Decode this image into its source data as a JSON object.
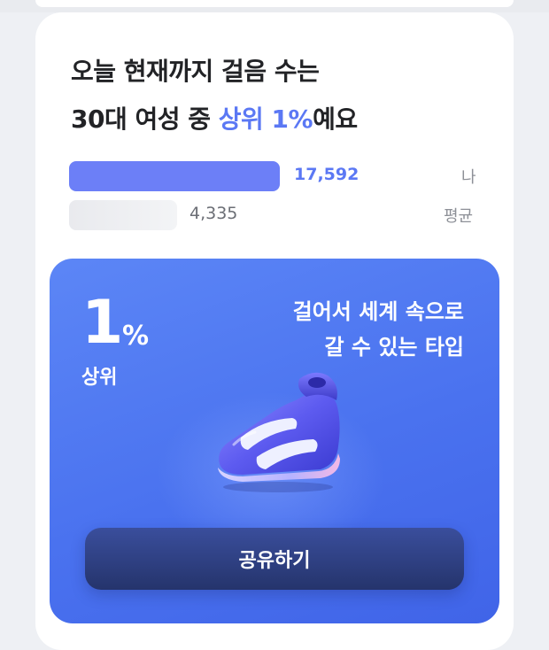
{
  "headline": {
    "line1": "오늘 현재까지 걸음 수는",
    "line2_prefix": "30대 여성 중 ",
    "line2_accent": "상위 1%",
    "line2_suffix": "예요"
  },
  "comparison": [
    {
      "id": "me",
      "value": "17,592",
      "label": "나",
      "fraction": 1.0,
      "color": "#6c7ff7"
    },
    {
      "id": "average",
      "value": "4,335",
      "label": "평균",
      "fraction": 0.46,
      "color": "#e9eaee"
    }
  ],
  "result": {
    "percent": "1",
    "percent_sign": "%",
    "rank_label": "상위",
    "type_line1": "걸어서 세계 속으로",
    "type_line2": "갈 수 있는 타입",
    "illustration": "sneaker-illustration"
  },
  "share_label": "공유하기"
}
